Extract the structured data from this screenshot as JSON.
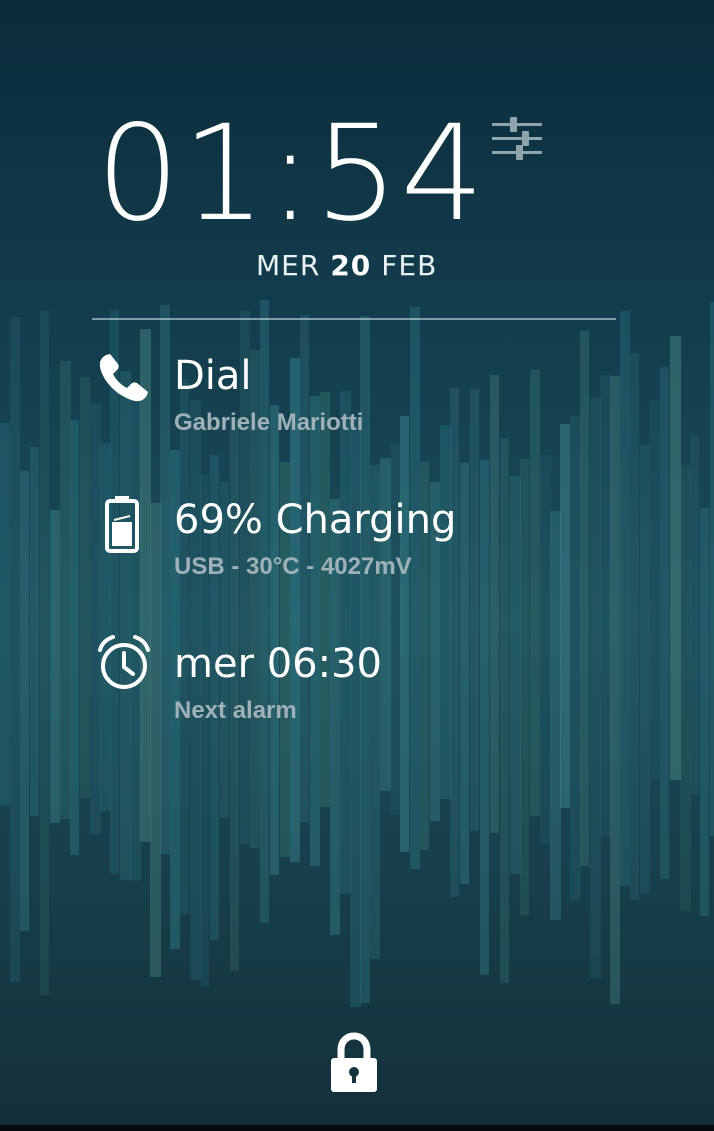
{
  "lockscreen": {
    "time": "01:54",
    "date": {
      "weekday": "MER",
      "day": "20",
      "month": "FEB"
    }
  },
  "notifications": [
    {
      "icon": "phone-icon",
      "title": "Dial",
      "subtitle": "Gabriele Mariotti"
    },
    {
      "icon": "battery-icon",
      "title": "69% Charging",
      "subtitle": "USB - 30°C - 4027mV"
    },
    {
      "icon": "alarm-clock-icon",
      "title": "mer 06:30",
      "subtitle": "Next alarm"
    }
  ],
  "colors": {
    "background_top": "#0b2b3a",
    "bar_teal": "#3a8a96",
    "subtitle_gray": "#9fb0b6"
  }
}
